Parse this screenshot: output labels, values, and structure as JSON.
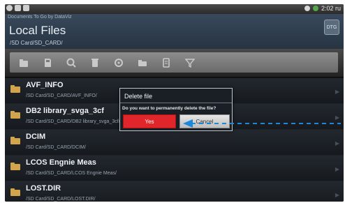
{
  "status_bar": {
    "time": "2:02 ru"
  },
  "header": {
    "app_subtitle": "Documents To Go by DataViz",
    "title": "Local Files",
    "path": "/SD Card/SD_CARD/",
    "corner_icon_label": "DTG"
  },
  "toolbar": {
    "icons": [
      "folder-up-icon",
      "sdcard-icon",
      "search-icon",
      "delete-icon",
      "refresh-icon",
      "new-folder-icon",
      "new-document-icon",
      "filter-icon"
    ]
  },
  "files": [
    {
      "name": "AVF_INFO",
      "path": "/SD Card/SD_CARD/AVF_INFO/"
    },
    {
      "name": "DB2 library_svga_3cf",
      "path": "/SD Card/SD_CARD/DB2 library_svga_3cf/"
    },
    {
      "name": "DCIM",
      "path": "/SD Card/SD_CARD/DCIM/"
    },
    {
      "name": "LCOS Engnie Meas",
      "path": "/SD Card/SD_CARD/LCOS Engnie Meas/"
    },
    {
      "name": "LOST.DIR",
      "path": "/SD Card/SD_CARD/LOST.DIR/"
    }
  ],
  "dialog": {
    "title": "Delete file",
    "message": "Do you want to permanently delete the file?",
    "yes_label": "Yes",
    "cancel_label": "Cancel"
  },
  "colors": {
    "header": "#2f3e4e",
    "yes_button": "#e0262a",
    "annotation_arrow": "#1e88d8",
    "folder": "#d2a54a"
  }
}
